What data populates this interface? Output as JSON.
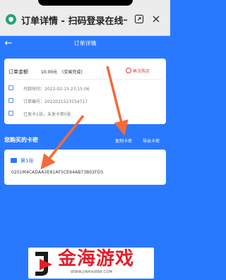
{
  "browser": {
    "title": "订单详情 - 扫码登录在线卡"
  },
  "navbar": {
    "back": "←",
    "title": "订单详情"
  },
  "order": {
    "amount_label": "订单金额",
    "amount_value": "10.00元",
    "amount_status": "(交易完成)",
    "rebuy_label": "再次购买",
    "paid_time": "付款时间：2022-02-15 23:15:06",
    "order_no": "订单编号：2022021523154717",
    "shipped": "已发卡1张，未发卡密0张"
  },
  "cards_section": {
    "title": "您购买的卡密",
    "copy_label": "复制卡密",
    "export_label": "导出卡密"
  },
  "card": {
    "label": "第1张",
    "code": "0201M4CADAA3E81AF5CE94AB73B02FD5"
  },
  "watermark": {
    "brand": "金海游戏",
    "url": "WWW.JINHAI888.COM"
  },
  "colors": {
    "accent": "#2979ff",
    "red": "#e53935",
    "arrow": "#f26a3a"
  },
  "icons": {
    "shield": "shield-icon",
    "external": "external-link-icon",
    "close": "close-icon",
    "back": "back-arrow-icon",
    "calendar": "calendar-icon",
    "document": "document-icon",
    "card": "card-icon",
    "folder": "folder-icon"
  }
}
